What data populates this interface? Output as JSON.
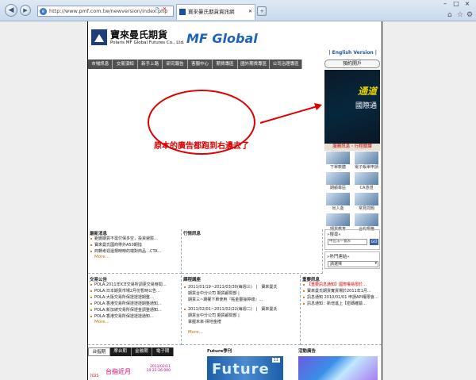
{
  "browser": {
    "url": "http://www.pmf.com.tw/newversion/index.php",
    "tab_title": "寶來曼氏期貨資訊網",
    "window_controls": [
      "–",
      "□",
      "×"
    ]
  },
  "header": {
    "logo_cn": "寶來曼氏期貨",
    "logo_en": "Polaris MF Global Futures Co., Ltd.",
    "logo_mf": "MF Global",
    "english_version": "| English Version |"
  },
  "menu": [
    "市場訊息",
    "交易須知",
    "新手上路",
    "研究報告",
    "客服中心",
    "期貨專區",
    "國外期貨專區",
    "公司治理專區"
  ],
  "open_account": "預約開戶",
  "ad": {
    "text1": "通道",
    "text2": "國際通"
  },
  "services": {
    "header": "服務訊息・行程關課",
    "items": [
      "下單軟體",
      "電子帳單申請",
      "期顧專區",
      "CA憑證",
      "出入金",
      "常見問題",
      "期貨教育",
      "合約規格"
    ]
  },
  "search": {
    "label": "»搜尋«",
    "placeholder": "中區法一覽表",
    "go": "GO"
  },
  "links": {
    "label": "»熱門連結«",
    "selected": "請選擇"
  },
  "panels": {
    "latest": {
      "title": "最新消息",
      "items": [
        "鉅變期貨不需付保多空，投資避險…",
        "寶來曼氏國商帶外A50期指",
        "商轉考週還規時時的端對商品…CTA…"
      ],
      "more": "More..."
    },
    "market": {
      "title": "行情訊息"
    },
    "trading": {
      "title": "交易公告",
      "items": [
        "POLA:2011年ICE交易所調更交易時間…",
        "POLA:日本期貨市場2月份暫時公告…",
        "POLA:大阪交易所保證證證期整…",
        "POLA:香港交易所保證證證期整通知…",
        "POLA:新加坡交易所保證金調整通知…",
        "POLA:香港交易所保證證證通知…"
      ],
      "more": "More..."
    },
    "course": {
      "title": "課程講座",
      "items": [
        {
          "line1": "2011/01/19~2011/03/30(每週三)　|　寶來曼氏",
          "line2": "期貨台中分公司 期貨顧問部 |",
          "line3": "期貨三~期權下單使用『點金靈操婷總』…"
        },
        {
          "line1": "2011/02/01~2011/02/22(每週二)　|　寶來曼氏",
          "line2": "期貨台中分公司 期貨顧問部 |",
          "line3": "掌握未來-擇地金禮"
        }
      ],
      "more": "More..."
    },
    "major": {
      "title": "重要訊息",
      "items": [
        "【重要訊息通知】國際權易限於…",
        "寶來曼氏期貨實貨場於2011年1月…",
        "訊息通知 2010/01/01 申請API權限會…",
        "訊息通知：新增進上【密碼確驗…"
      ]
    }
  },
  "footer": {
    "tabs": [
      "台指期",
      "摩台期",
      "金融期",
      "電子期"
    ],
    "ticker_big": "台指近月",
    "ticker_date": "2011/02/11",
    "ticker_time": "10:22:26:000",
    "ticker_label": "7025",
    "future_title": "Future季刊",
    "future_logo": "Future",
    "future_issue": "11",
    "activity_title": "活動廣告"
  },
  "annotation": {
    "text": "原本的廣告都跑到右邊去了",
    "color": "#e00000"
  }
}
